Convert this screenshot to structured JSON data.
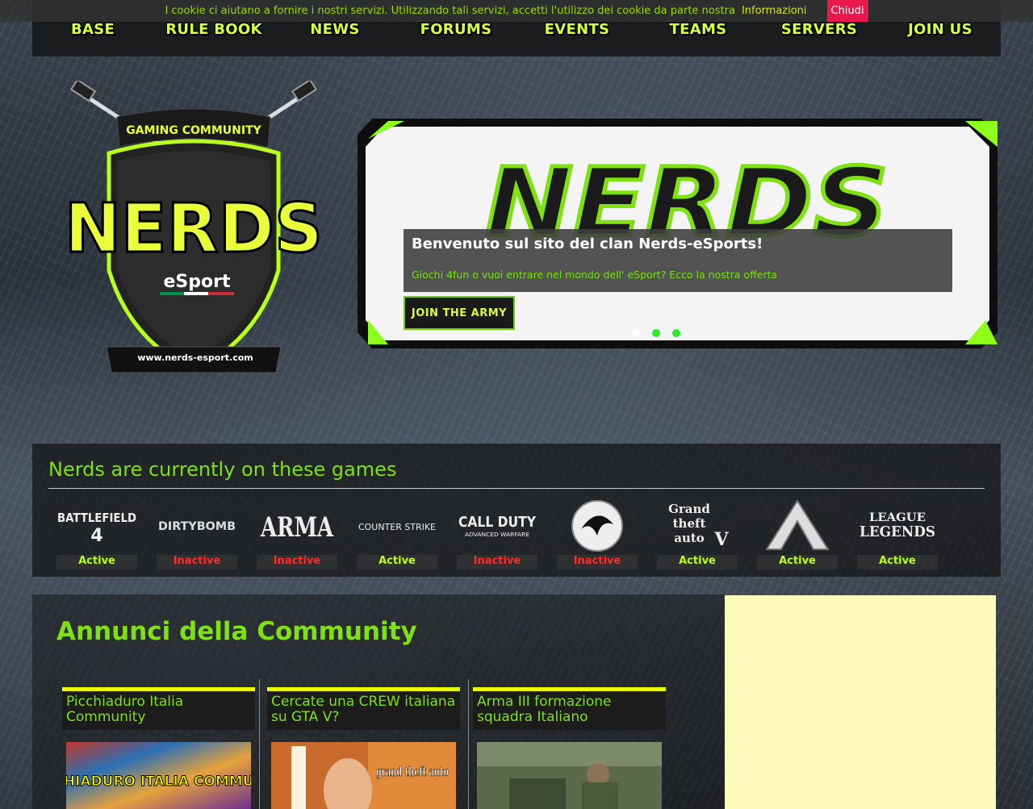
{
  "cookie": {
    "message": "I cookie ci aiutano a fornire i nostri servizi. Utilizzando tali servizi, accetti l'utilizzo dei cookie da parte nostra",
    "info_label": "Informazioni",
    "close_label": "Chiudi"
  },
  "nav": {
    "items": [
      "BASE",
      "RULE BOOK",
      "NEWS",
      "FORUMS",
      "EVENTS",
      "TEAMS",
      "SERVERS",
      "JOIN US"
    ]
  },
  "logo": {
    "top_text": "GAMING COMMUNITY",
    "main_text": "NERDS",
    "sub_text": "eSport",
    "url_text": "www.nerds-esport.com"
  },
  "slider": {
    "brand_text": "NERDS",
    "title": "Benvenuto sul sito del clan Nerds-eSports!",
    "subtitle": "Giochi 4fun o vuoi entrare nel mondo dell' eSport? Ecco la nostra offerta",
    "button_label": "JOIN THE ARMY",
    "slide_count": 3,
    "active_slide": 1
  },
  "games": {
    "heading": "Nerds are currently on these games",
    "items": [
      {
        "name": "BATTLEFIELD 4",
        "status": "Active",
        "active": true
      },
      {
        "name": "DIRTY BOMB",
        "status": "Inactive",
        "active": false
      },
      {
        "name": "ARMA III",
        "status": "Inactive",
        "active": false
      },
      {
        "name": "COUNTER STRIKE",
        "status": "Active",
        "active": true
      },
      {
        "name": "CALL OF DUTY ADVANCED WARFARE",
        "status": "Inactive",
        "active": false
      },
      {
        "name": "MORTAL KOMBAT",
        "status": "Inactive",
        "active": false
      },
      {
        "name": "GRAND THEFT AUTO V",
        "status": "Active",
        "active": true
      },
      {
        "name": "ARK",
        "status": "Active",
        "active": true
      },
      {
        "name": "LEAGUE OF LEGENDS",
        "status": "Active",
        "active": true
      }
    ]
  },
  "community": {
    "heading": "Annunci della Community",
    "announcements": [
      {
        "title": "Picchiaduro Italia Community",
        "image_text": "PICCHIADURO ITALIA COMMUNITY"
      },
      {
        "title": "Cercate una CREW italiana su GTA V?",
        "image_text": "grand theft auto"
      },
      {
        "title": "Arma III formazione squadra Italiano",
        "image_text": ""
      }
    ]
  },
  "colors": {
    "accent": "#7fe012",
    "nav_text": "#d8ff3a",
    "active": "#b9ff1a",
    "inactive": "#ff2a2a",
    "cookie_close": "#e8174c",
    "ad_bg": "#fffbbf"
  }
}
